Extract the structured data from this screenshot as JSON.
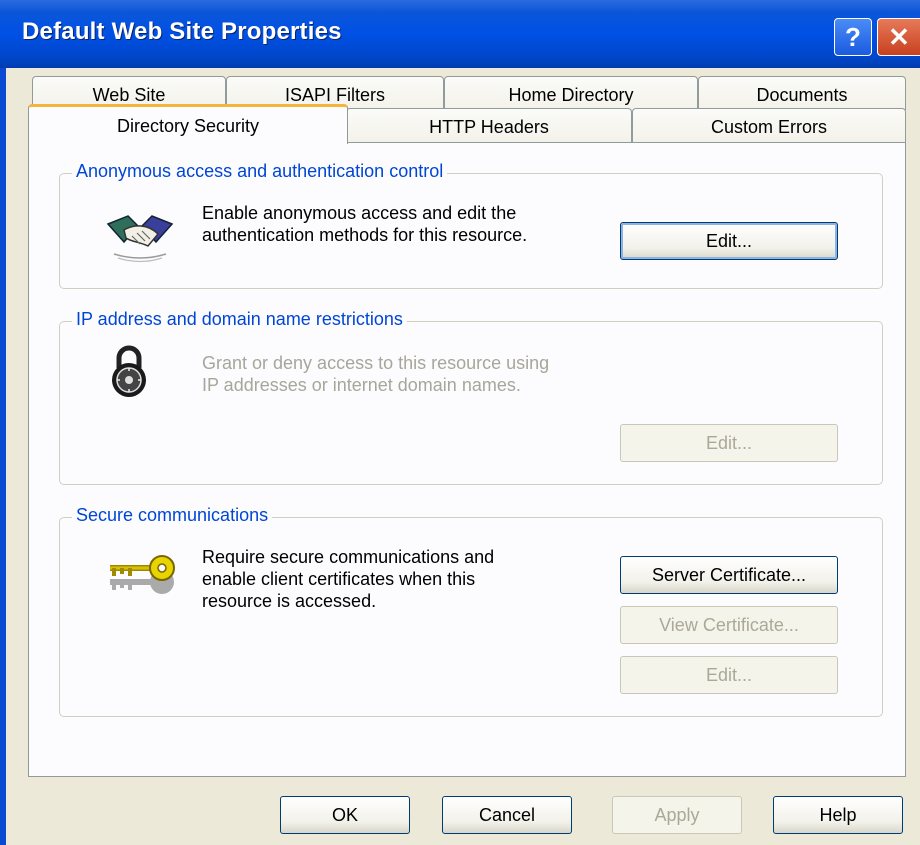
{
  "window": {
    "title": "Default Web Site Properties"
  },
  "tabs": {
    "row1": [
      "Web Site",
      "ISAPI Filters",
      "Home Directory",
      "Documents"
    ],
    "row2": [
      "Directory Security",
      "HTTP Headers",
      "Custom Errors"
    ],
    "active": "Directory Security"
  },
  "anonymous": {
    "title": "Anonymous access and authentication control",
    "line1": "Enable anonymous access and edit the",
    "line2": "authentication methods for this resource.",
    "edit_label": "Edit..."
  },
  "ip": {
    "title": "IP address and domain name restrictions",
    "line1": "Grant or deny access to this resource using",
    "line2": "IP addresses or internet domain names.",
    "edit_label": "Edit..."
  },
  "secure": {
    "title": "Secure communications",
    "line1": "Require secure communications and",
    "line2": "enable client certificates when this",
    "line3": "resource is accessed.",
    "server_cert_label": "Server Certificate...",
    "view_cert_label": "View Certificate...",
    "edit_label": "Edit..."
  },
  "footer": {
    "ok": "OK",
    "cancel": "Cancel",
    "apply": "Apply",
    "help": "Help"
  },
  "icons": [
    "handshake-icon",
    "combination-lock-icon",
    "key-icon",
    "help-icon",
    "close-icon"
  ]
}
